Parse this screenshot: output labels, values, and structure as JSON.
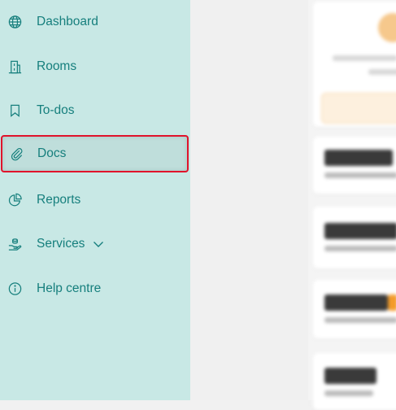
{
  "sidebar": {
    "items": [
      {
        "label": "Dashboard",
        "icon": "globe-icon"
      },
      {
        "label": "Rooms",
        "icon": "building-icon"
      },
      {
        "label": "To-dos",
        "icon": "bookmark-icon"
      },
      {
        "label": "Docs",
        "icon": "paperclip-icon",
        "selected": true
      },
      {
        "label": "Reports",
        "icon": "pie-chart-icon"
      },
      {
        "label": "Services",
        "icon": "hand-coins-icon",
        "has_dropdown": true
      },
      {
        "label": "Help centre",
        "icon": "info-icon"
      }
    ]
  },
  "colors": {
    "sidebar_bg": "#c8e8e5",
    "nav_text": "#167f7d",
    "selection_outline": "#e0132b",
    "accent": "#f39b2a"
  }
}
